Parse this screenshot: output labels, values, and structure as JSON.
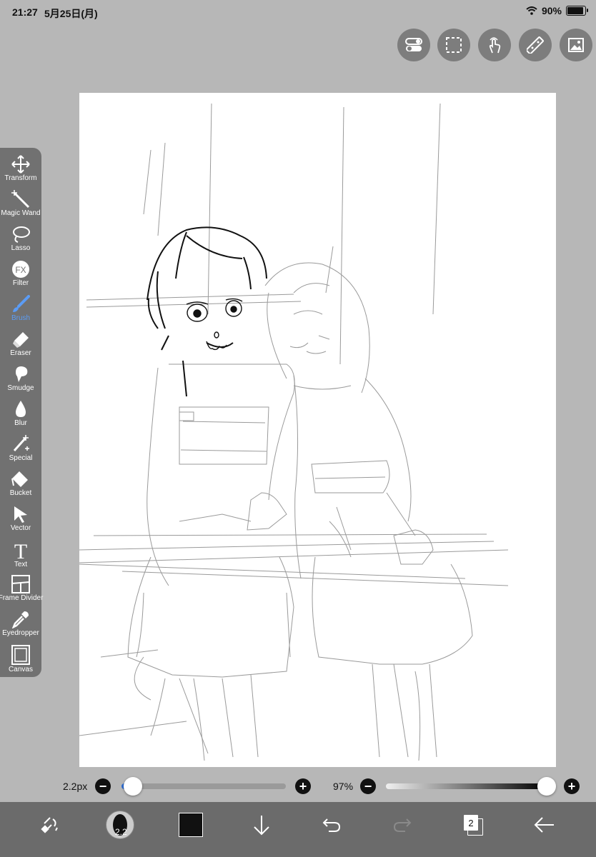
{
  "status": {
    "time": "21:27",
    "date": "5月25日(月)",
    "battery": "90%",
    "battery_level": 0.9
  },
  "top_buttons": [
    "toggle-icon",
    "selection-icon",
    "gesture-icon",
    "ruler-icon",
    "image-icon"
  ],
  "tools": [
    {
      "label": "Transform",
      "icon": "transform-icon"
    },
    {
      "label": "Magic Wand",
      "icon": "magic-wand-icon"
    },
    {
      "label": "Lasso",
      "icon": "lasso-icon"
    },
    {
      "label": "Filter",
      "icon": "filter-icon"
    },
    {
      "label": "Brush",
      "icon": "brush-icon"
    },
    {
      "label": "Eraser",
      "icon": "eraser-icon"
    },
    {
      "label": "Smudge",
      "icon": "smudge-icon"
    },
    {
      "label": "Blur",
      "icon": "blur-icon"
    },
    {
      "label": "Special",
      "icon": "special-icon"
    },
    {
      "label": "Bucket",
      "icon": "bucket-icon"
    },
    {
      "label": "Vector",
      "icon": "vector-icon"
    },
    {
      "label": "Text",
      "icon": "text-icon"
    },
    {
      "label": "Frame Divider",
      "icon": "frame-divider-icon"
    },
    {
      "label": "Eyedropper",
      "icon": "eyedropper-icon"
    },
    {
      "label": "Canvas",
      "icon": "canvas-icon"
    }
  ],
  "active_tool": "Brush",
  "brush": {
    "size_label": "2.2px",
    "size_fraction": 0.02,
    "minus": "−",
    "plus": "+"
  },
  "opacity": {
    "label": "97%",
    "value_fraction": 0.97,
    "minus": "−",
    "plus": "+"
  },
  "bottom": {
    "brush_preview_label": "2.2",
    "layer_count": "2",
    "color": "#111111"
  },
  "colors": {
    "accent": "#5b9cf5",
    "toolbar": "#717171",
    "bottom_bar": "#6b6b6b",
    "background": "#b7b7b7"
  }
}
